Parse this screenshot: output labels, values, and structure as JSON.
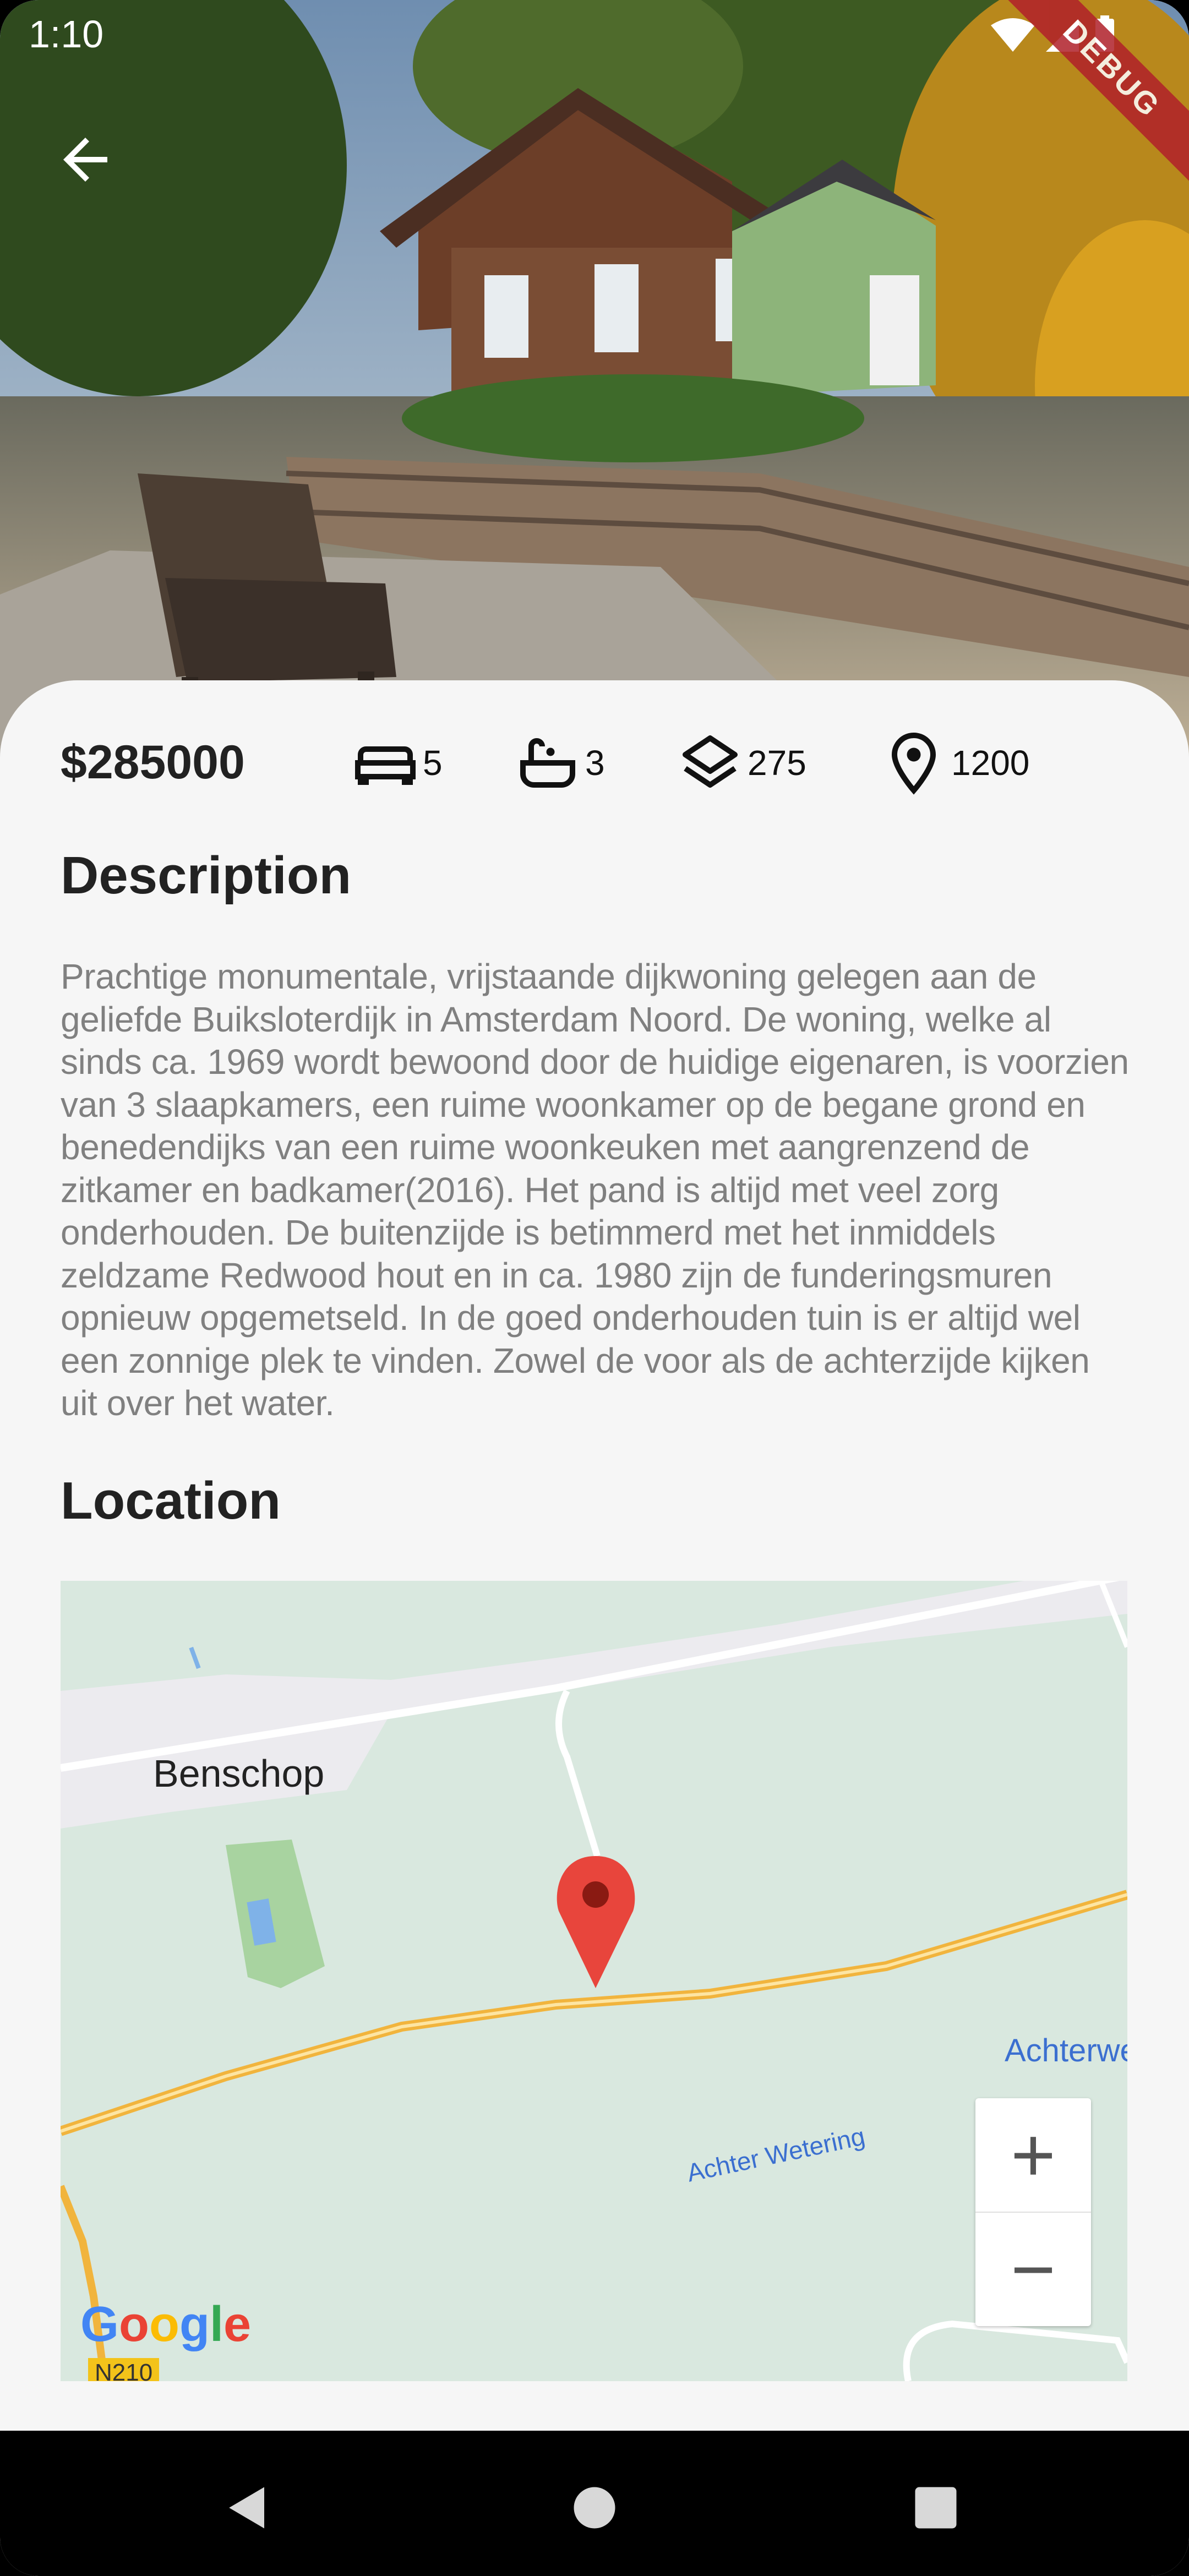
{
  "status_bar": {
    "time": "1:10",
    "icons": [
      "wifi-icon",
      "signal-icon",
      "battery-icon"
    ]
  },
  "debug_banner": "DEBUG",
  "header": {
    "back_icon": "arrow-back-icon"
  },
  "listing": {
    "price": "$285000",
    "features": [
      {
        "icon": "bed-icon",
        "value": "5"
      },
      {
        "icon": "bathtub-icon",
        "value": "3"
      },
      {
        "icon": "layers-icon",
        "value": "275"
      },
      {
        "icon": "location-pin-icon",
        "value": "1200"
      }
    ]
  },
  "description": {
    "heading": "Description",
    "text": "Prachtige monumentale, vrijstaande dijkwoning gelegen aan de geliefde Buiksloterdijk in Amsterdam Noord. De woning, welke al sinds ca. 1969 wordt bewoond door de huidige eigenaren, is voorzien van 3 slaapkamers, een ruime woonkamer op de begane grond en benedendijks van een ruime woonkeuken met aangrenzend de zitkamer en badkamer(2016). Het pand is altijd met veel zorg onderhouden. De buitenzijde is betimmerd met het inmiddels zeldzame Redwood hout en in ca. 1980 zijn de funderingsmuren opnieuw opgemetseld. In de goed onderhouden tuin is er altijd wel een zonnige plek te vinden. Zowel de voor als de achterzijde kijken uit over het water."
  },
  "location": {
    "heading": "Location",
    "map": {
      "town_label": "Benschop",
      "water_label": "Achter Wetering",
      "edge_label": "Achterwet",
      "road_label": "N210",
      "logo": "Google",
      "zoom_in": "+",
      "zoom_out": "−"
    }
  },
  "nav": [
    "back-nav-icon",
    "home-nav-icon",
    "recents-nav-icon"
  ]
}
